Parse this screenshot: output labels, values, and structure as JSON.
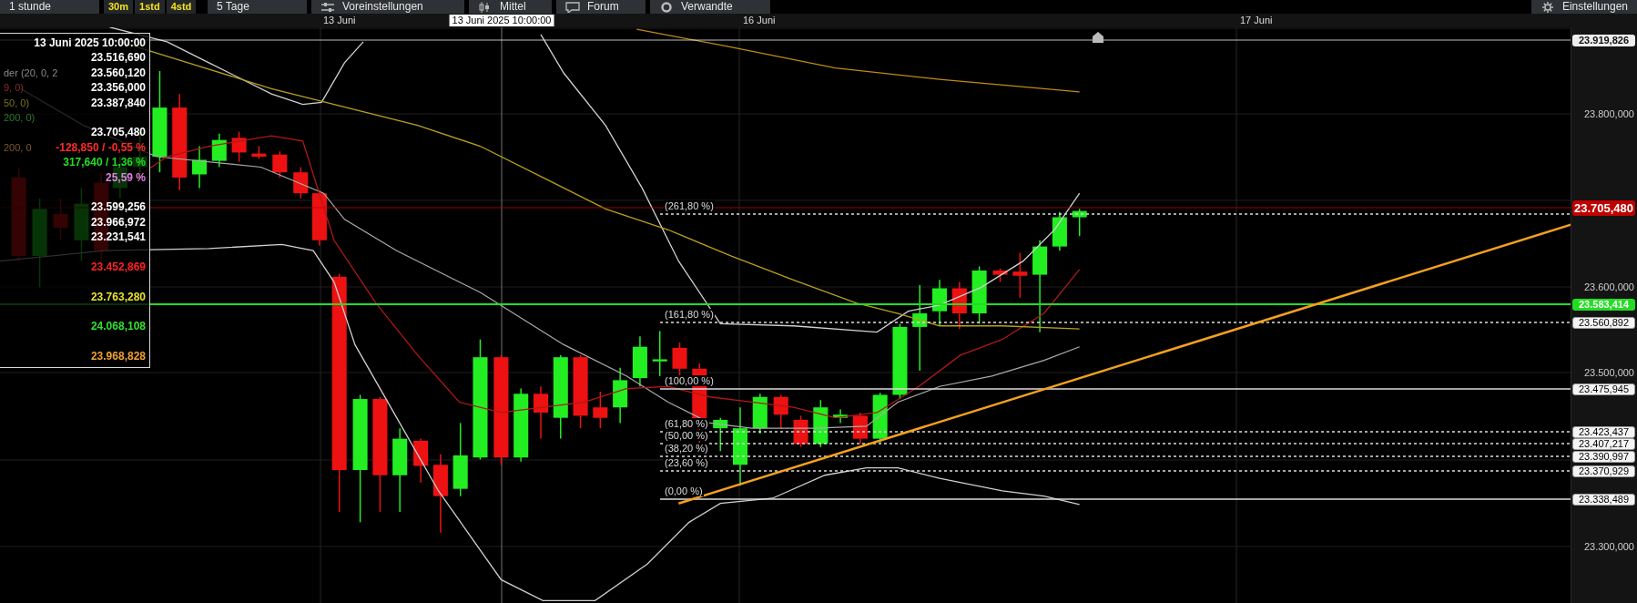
{
  "toolbar": {
    "interval": "1 stunde",
    "periods": [
      "30m",
      "1std",
      "4std"
    ],
    "range": "5 Tage",
    "buttons": [
      {
        "label": "Voreinstellungen",
        "kind": "sliders"
      },
      {
        "label": "Mittel",
        "kind": "candles"
      },
      {
        "label": "Forum",
        "kind": "bubble"
      },
      {
        "label": "Verwandte",
        "kind": "ring"
      }
    ],
    "settings": "Einstellungen"
  },
  "date_axis": {
    "labels": [
      "13 Juni",
      "16 Juni",
      "17 Juni"
    ],
    "cursor": "13 Juni 2025 10:00:00"
  },
  "data_panel": {
    "title": "13 Juni 2025 10:00:00",
    "groups": [
      [
        {
          "value": "23.516,690",
          "color": "#ffffff"
        },
        {
          "value": "23.560,120",
          "color": "#ffffff",
          "legend": {
            "text": "der (20, 0, 2",
            "color": "#8a8a8a"
          }
        },
        {
          "value": "23.356,000",
          "color": "#ffffff",
          "legend": {
            "text": "9, 0)",
            "color": "#8a2a2a"
          }
        },
        {
          "value": "23.387,840",
          "color": "#ffffff",
          "legend": {
            "text": "50, 0)",
            "color": "#7a7020"
          }
        },
        {
          "legend": {
            "text": "200, 0)",
            "color": "#2a7a2a"
          }
        },
        {
          "value": "23.705,480",
          "color": "#ffffff"
        },
        {
          "value": "-128,850 / -0,55 %",
          "color": "#ff2a2a",
          "legend": {
            "text": "200, 0",
            "color": "#7a5a2a"
          }
        },
        {
          "value": "317,640 / 1,36 %",
          "color": "#22dd22"
        },
        {
          "value": "25,59 %",
          "color": "#e080e0"
        }
      ],
      [
        {
          "value": "23.599,256",
          "color": "#ffffff"
        },
        {
          "value": "23.966,972",
          "color": "#ffffff"
        },
        {
          "value": "23.231,541",
          "color": "#ffffff"
        }
      ],
      [
        {
          "value": "23.452,869",
          "color": "#ff2020"
        }
      ],
      [
        {
          "value": "23.763,280",
          "color": "#e8e030"
        }
      ],
      [
        {
          "value": "24.068,108",
          "color": "#30e030"
        }
      ],
      [
        {
          "value": "23.968,828",
          "color": "#f0a030"
        }
      ]
    ]
  },
  "fibonacci": {
    "levels": [
      {
        "label": "(261,80 %)",
        "kind": "dotted"
      },
      {
        "label": "(161,80 %)",
        "kind": "dotted",
        "price": "23.560,892"
      },
      {
        "label": "(100,00 %)",
        "kind": "solid",
        "price": "23.475,945"
      },
      {
        "label": "(61,80 %)",
        "kind": "dotted",
        "price": "23.423,437"
      },
      {
        "label": "(50,00 %)",
        "kind": "dotted",
        "price": "23.407,217"
      },
      {
        "label": "(38,20 %)",
        "kind": "dotted",
        "price": "23.390,997"
      },
      {
        "label": "(23,60 %)",
        "kind": "dotted",
        "price": "23.370,929"
      },
      {
        "label": "(0,00 %)",
        "kind": "solid",
        "price": "23.338,489"
      }
    ]
  },
  "price_axis": {
    "ticks": [
      "23.800,000",
      "23.600,000",
      "23.500,000",
      "23.300,000"
    ],
    "markers": [
      {
        "text": "23.919,826",
        "color": "#eeeeee"
      },
      {
        "text": "23.705,480",
        "color": "#c00000"
      },
      {
        "text": "23.583,414",
        "color": "#22dd22"
      }
    ]
  }
}
